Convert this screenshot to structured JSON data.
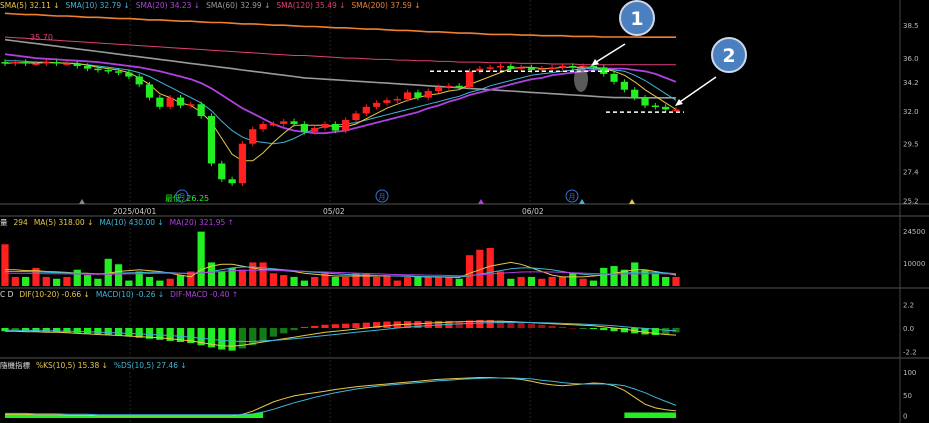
{
  "legends": {
    "price": [
      {
        "text": "SMA(5) 32.11 ↓",
        "color": "#e8c84a"
      },
      {
        "text": "SMA(10) 32.79 ↓",
        "color": "#3fb6d8"
      },
      {
        "text": "SMA(20) 34.23 ↓",
        "color": "#b040e0"
      },
      {
        "text": "SMA(60) 32.99 ↓",
        "color": "#9a9a9a"
      },
      {
        "text": "SMA(120) 35.49 ↓",
        "color": "#e0407a"
      },
      {
        "text": "SMA(200) 37.59 ↓",
        "color": "#f08030"
      }
    ],
    "volume": [
      {
        "text": "量",
        "color": "#dddddd"
      },
      {
        "text": "294",
        "color": "#e8c84a"
      },
      {
        "text": "MA(5) 318.00 ↓",
        "color": "#e8c84a"
      },
      {
        "text": "MA(10) 430.00 ↓",
        "color": "#3fb6d8"
      },
      {
        "text": "MA(20) 321.95 ↑",
        "color": "#b040e0"
      }
    ],
    "macd": [
      {
        "text": "C D",
        "color": "#dddddd"
      },
      {
        "text": "DIF(10-20) -0.66 ↓",
        "color": "#e8c84a"
      },
      {
        "text": "MACD(10) -0.26 ↓",
        "color": "#3fb6d8"
      },
      {
        "text": "DIF-MACD -0.40 ↑",
        "color": "#b040e0"
      }
    ],
    "kd": [
      {
        "text": "隨機指標",
        "color": "#dddddd"
      },
      {
        "text": "%KS(10,5) 15.38 ↓",
        "color": "#e8c84a"
      },
      {
        "text": "%DS(10,5) 27.46 ↓",
        "color": "#3fb6d8"
      }
    ]
  },
  "annotations": {
    "low_label": "最低: 26.25",
    "marker_1": "1",
    "marker_2": "2",
    "month_badge": "月",
    "top_left_value": "35.70"
  },
  "colors": {
    "up": "#ff2020",
    "down": "#22ee22",
    "sma5": "#e8c84a",
    "sma10": "#3fb6d8",
    "sma20": "#b040e0",
    "sma60": "#9a9a9a",
    "sma120": "#e0407a",
    "sma200": "#f08030",
    "grid": "#262626",
    "marker": "#4a7fc0"
  },
  "chart_data": [
    {
      "type": "candlestick",
      "title": "",
      "x_labels": [
        "2025/04/01",
        "05/02",
        "06/02"
      ],
      "ylim": [
        25,
        39.5
      ],
      "y_ticks": [
        25.2,
        27.4,
        29.5,
        32.0,
        34.2,
        36.0,
        38.5
      ],
      "close": [
        35.6,
        35.7,
        35.6,
        35.6,
        35.7,
        35.6,
        35.6,
        35.4,
        35.2,
        35.1,
        35.0,
        34.9,
        34.6,
        34.0,
        33.0,
        32.3,
        33.0,
        32.4,
        32.5,
        31.6,
        28.0,
        26.8,
        26.5,
        29.5,
        30.6,
        31.0,
        31.0,
        31.2,
        31.0,
        30.4,
        30.7,
        31.0,
        30.5,
        31.3,
        31.8,
        32.3,
        32.6,
        32.8,
        32.9,
        33.4,
        33.0,
        33.5,
        33.8,
        33.9,
        33.8,
        35.0,
        35.2,
        35.3,
        35.4,
        35.2,
        35.3,
        35.1,
        35.2,
        35.3,
        35.4,
        35.3,
        35.4,
        35.3,
        34.8,
        34.2,
        33.6,
        33.0,
        32.4,
        32.3,
        32.1,
        32.1
      ],
      "sma5": [
        35.6,
        35.65,
        35.63,
        35.63,
        35.64,
        35.64,
        35.62,
        35.6,
        35.45,
        35.3,
        35.2,
        35.1,
        34.9,
        34.5,
        34.0,
        33.3,
        33.0,
        32.6,
        32.4,
        31.9,
        31.1,
        29.9,
        28.7,
        28.2,
        28.2,
        28.8,
        29.6,
        30.3,
        30.9,
        30.9,
        30.9,
        30.9,
        30.8,
        30.8,
        31.0,
        31.4,
        31.8,
        32.2,
        32.5,
        32.8,
        33.0,
        33.2,
        33.3,
        33.5,
        33.6,
        34.0,
        34.3,
        34.6,
        34.9,
        35.2,
        35.3,
        35.3,
        35.2,
        35.2,
        35.3,
        35.3,
        35.3,
        35.3,
        35.2,
        35.0,
        34.7,
        34.2,
        33.6,
        33.1,
        32.6,
        32.1
      ],
      "sma10": [
        35.8,
        35.8,
        35.75,
        35.7,
        35.7,
        35.65,
        35.6,
        35.55,
        35.5,
        35.4,
        35.3,
        35.2,
        35.1,
        34.9,
        34.6,
        34.2,
        33.8,
        33.4,
        33.0,
        32.6,
        32.0,
        31.2,
        30.5,
        30.0,
        29.7,
        29.6,
        29.5,
        29.6,
        29.9,
        30.3,
        30.6,
        30.8,
        30.9,
        31.0,
        31.1,
        31.3,
        31.5,
        31.7,
        31.9,
        32.1,
        32.3,
        32.5,
        32.7,
        32.9,
        33.1,
        33.4,
        33.6,
        33.9,
        34.1,
        34.3,
        34.5,
        34.7,
        34.8,
        34.9,
        35.0,
        35.1,
        35.2,
        35.2,
        35.2,
        35.1,
        35.0,
        34.7,
        34.3,
        33.8,
        33.3,
        32.8
      ],
      "sma20": [
        36.3,
        36.2,
        36.1,
        36.0,
        35.95,
        35.9,
        35.85,
        35.8,
        35.75,
        35.7,
        35.6,
        35.5,
        35.4,
        35.3,
        35.15,
        35.0,
        34.8,
        34.6,
        34.4,
        34.1,
        33.7,
        33.2,
        32.7,
        32.2,
        31.8,
        31.4,
        31.0,
        30.7,
        30.5,
        30.4,
        30.3,
        30.3,
        30.4,
        30.5,
        30.7,
        30.9,
        31.1,
        31.3,
        31.5,
        31.7,
        31.9,
        32.2,
        32.4,
        32.7,
        32.9,
        33.2,
        33.4,
        33.6,
        33.8,
        34.0,
        34.2,
        34.4,
        34.5,
        34.7,
        34.8,
        34.9,
        35.0,
        35.1,
        35.2,
        35.2,
        35.2,
        35.1,
        35.0,
        34.8,
        34.5,
        34.2
      ],
      "sma60": [
        37.4,
        37.3,
        37.2,
        37.1,
        37.0,
        36.9,
        36.8,
        36.7,
        36.6,
        36.5,
        36.4,
        36.3,
        36.2,
        36.1,
        36.0,
        35.9,
        35.8,
        35.7,
        35.6,
        35.5,
        35.4,
        35.3,
        35.2,
        35.1,
        35.0,
        34.9,
        34.8,
        34.7,
        34.6,
        34.5,
        34.45,
        34.4,
        34.35,
        34.3,
        34.25,
        34.2,
        34.15,
        34.1,
        34.05,
        34.0,
        33.95,
        33.9,
        33.85,
        33.8,
        33.75,
        33.7,
        33.65,
        33.6,
        33.55,
        33.5,
        33.45,
        33.4,
        33.35,
        33.3,
        33.25,
        33.2,
        33.15,
        33.1,
        33.05,
        33.0,
        33.0,
        32.99,
        32.99,
        32.99,
        32.99,
        32.99
      ],
      "sma120": [
        37.6,
        37.55,
        37.5,
        37.45,
        37.4,
        37.35,
        37.3,
        37.25,
        37.2,
        37.15,
        37.1,
        37.05,
        37.0,
        36.95,
        36.9,
        36.85,
        36.8,
        36.75,
        36.7,
        36.65,
        36.6,
        36.55,
        36.5,
        36.45,
        36.4,
        36.35,
        36.3,
        36.25,
        36.2,
        36.2,
        36.15,
        36.1,
        36.05,
        36.0,
        36.0,
        35.95,
        35.9,
        35.9,
        35.85,
        35.85,
        35.8,
        35.8,
        35.75,
        35.75,
        35.7,
        35.7,
        35.7,
        35.65,
        35.65,
        35.65,
        35.6,
        35.6,
        35.6,
        35.55,
        35.55,
        35.55,
        35.5,
        35.5,
        35.5,
        35.5,
        35.5,
        35.5,
        35.49,
        35.49,
        35.49,
        35.49
      ],
      "sma200": [
        39.4,
        39.35,
        39.3,
        39.3,
        39.25,
        39.2,
        39.2,
        39.15,
        39.1,
        39.1,
        39.05,
        39.0,
        39.0,
        38.95,
        38.9,
        38.9,
        38.85,
        38.8,
        38.8,
        38.75,
        38.7,
        38.7,
        38.65,
        38.6,
        38.6,
        38.55,
        38.5,
        38.5,
        38.45,
        38.4,
        38.4,
        38.35,
        38.3,
        38.3,
        38.25,
        38.2,
        38.2,
        38.15,
        38.1,
        38.1,
        38.05,
        38.0,
        38.0,
        37.95,
        37.9,
        37.9,
        37.85,
        37.8,
        37.8,
        37.8,
        37.75,
        37.75,
        37.7,
        37.7,
        37.7,
        37.65,
        37.65,
        37.65,
        37.6,
        37.6,
        37.6,
        37.6,
        37.59,
        37.59,
        37.59,
        37.59
      ]
    },
    {
      "type": "bar",
      "title": "",
      "y_ticks": [
        "24500",
        "10000"
      ],
      "volume": [
        2300,
        500,
        500,
        1000,
        500,
        400,
        500,
        900,
        600,
        400,
        1500,
        1200,
        300,
        800,
        500,
        300,
        400,
        600,
        800,
        3000,
        1300,
        800,
        1000,
        900,
        1300,
        1300,
        700,
        600,
        500,
        300,
        500,
        700,
        500,
        500,
        700,
        700,
        500,
        600,
        300,
        500,
        500,
        500,
        500,
        500,
        400,
        1700,
        2000,
        2100,
        800,
        400,
        500,
        500,
        400,
        500,
        500,
        700,
        400,
        300,
        1000,
        1100,
        900,
        1300,
        900,
        700,
        500,
        500
      ],
      "ma5": [
        900,
        900,
        850,
        850,
        800,
        780,
        750,
        700,
        700,
        650,
        700,
        800,
        850,
        900,
        850,
        800,
        700,
        600,
        500,
        900,
        1100,
        1200,
        1200,
        1100,
        1000,
        900,
        900,
        850,
        800,
        700,
        650,
        600,
        550,
        550,
        550,
        550,
        550,
        550,
        550,
        550,
        520,
        500,
        500,
        480,
        470,
        700,
        900,
        1100,
        1200,
        1300,
        1200,
        1000,
        800,
        600,
        500,
        500,
        500,
        550,
        600,
        700,
        800,
        900,
        900,
        800,
        700,
        600
      ],
      "ma10": [
        800,
        800,
        800,
        780,
        760,
        740,
        720,
        700,
        690,
        680,
        680,
        700,
        720,
        740,
        760,
        760,
        740,
        700,
        680,
        700,
        800,
        900,
        1000,
        1050,
        1050,
        1000,
        950,
        900,
        850,
        800,
        760,
        720,
        680,
        640,
        620,
        600,
        580,
        560,
        550,
        540,
        530,
        520,
        510,
        500,
        500,
        550,
        650,
        750,
        850,
        950,
        1000,
        1000,
        950,
        900,
        800,
        700,
        650,
        600,
        600,
        650,
        700,
        750,
        780,
        750,
        720,
        680
      ],
      "ma20": [
        700,
        700,
        700,
        690,
        680,
        680,
        670,
        660,
        650,
        650,
        650,
        660,
        670,
        680,
        690,
        700,
        700,
        700,
        700,
        720,
        760,
        800,
        840,
        860,
        870,
        870,
        860,
        850,
        830,
        810,
        790,
        770,
        750,
        730,
        710,
        690,
        670,
        650,
        630,
        620,
        610,
        600,
        590,
        580,
        570,
        580,
        620,
        660,
        700,
        740,
        770,
        780,
        780,
        770,
        750,
        730,
        710,
        690,
        670,
        660,
        660,
        670,
        680,
        680,
        670,
        660
      ]
    },
    {
      "type": "bar",
      "title": "",
      "y_ticks": [
        "2.2",
        "0.0",
        "-2.2"
      ],
      "osc": [
        -0.3,
        -0.25,
        -0.3,
        -0.35,
        -0.35,
        -0.4,
        -0.4,
        -0.45,
        -0.5,
        -0.55,
        -0.6,
        -0.7,
        -0.8,
        -0.9,
        -1.0,
        -1.1,
        -1.2,
        -1.3,
        -1.4,
        -1.6,
        -1.8,
        -2.0,
        -2.1,
        -1.9,
        -1.6,
        -1.2,
        -0.8,
        -0.5,
        -0.2,
        0.1,
        0.2,
        0.3,
        0.35,
        0.4,
        0.45,
        0.5,
        0.55,
        0.6,
        0.62,
        0.64,
        0.65,
        0.66,
        0.66,
        0.66,
        0.64,
        0.7,
        0.74,
        0.74,
        0.7,
        0.6,
        0.5,
        0.4,
        0.3,
        0.2,
        0.1,
        0.0,
        -0.05,
        -0.1,
        -0.2,
        -0.3,
        -0.4,
        -0.5,
        -0.6,
        -0.65,
        -0.6,
        -0.4
      ],
      "dif": [
        -0.3,
        -0.3,
        -0.35,
        -0.35,
        -0.4,
        -0.4,
        -0.45,
        -0.5,
        -0.55,
        -0.6,
        -0.65,
        -0.7,
        -0.75,
        -0.8,
        -0.85,
        -0.9,
        -1.0,
        -1.1,
        -1.2,
        -1.35,
        -1.5,
        -1.65,
        -1.7,
        -1.6,
        -1.45,
        -1.3,
        -1.15,
        -1.0,
        -0.85,
        -0.7,
        -0.55,
        -0.4,
        -0.3,
        -0.2,
        -0.1,
        0.0,
        0.1,
        0.2,
        0.3,
        0.35,
        0.4,
        0.45,
        0.5,
        0.55,
        0.58,
        0.6,
        0.62,
        0.63,
        0.62,
        0.6,
        0.55,
        0.5,
        0.45,
        0.4,
        0.35,
        0.3,
        0.25,
        0.2,
        0.1,
        0.0,
        -0.1,
        -0.25,
        -0.4,
        -0.5,
        -0.6,
        -0.66
      ],
      "macd": [
        -0.2,
        -0.2,
        -0.22,
        -0.24,
        -0.26,
        -0.28,
        -0.3,
        -0.32,
        -0.35,
        -0.38,
        -0.42,
        -0.46,
        -0.5,
        -0.55,
        -0.6,
        -0.65,
        -0.7,
        -0.78,
        -0.86,
        -0.95,
        -1.05,
        -1.15,
        -1.22,
        -1.25,
        -1.24,
        -1.2,
        -1.15,
        -1.08,
        -1.0,
        -0.9,
        -0.8,
        -0.7,
        -0.6,
        -0.5,
        -0.4,
        -0.3,
        -0.2,
        -0.1,
        0.0,
        0.08,
        0.15,
        0.22,
        0.28,
        0.33,
        0.38,
        0.42,
        0.46,
        0.49,
        0.51,
        0.52,
        0.52,
        0.51,
        0.49,
        0.46,
        0.43,
        0.4,
        0.36,
        0.32,
        0.27,
        0.2,
        0.12,
        0.04,
        -0.04,
        -0.12,
        -0.2,
        -0.26
      ]
    },
    {
      "type": "line",
      "title": "",
      "y_ticks": [
        "100",
        "50",
        "0"
      ],
      "k": [
        8,
        8,
        8,
        7,
        7,
        7,
        6,
        6,
        6,
        5,
        5,
        5,
        5,
        5,
        5,
        5,
        5,
        5,
        5,
        5,
        5,
        5,
        5,
        8,
        15,
        25,
        35,
        42,
        48,
        52,
        55,
        58,
        62,
        65,
        68,
        70,
        72,
        74,
        76,
        78,
        80,
        82,
        84,
        85,
        86,
        87,
        88,
        88,
        87,
        86,
        84,
        80,
        75,
        72,
        70,
        72,
        74,
        76,
        75,
        70,
        60,
        45,
        30,
        22,
        18,
        15.38
      ],
      "d": [
        10,
        10,
        10,
        9,
        9,
        9,
        8,
        8,
        8,
        7,
        7,
        7,
        7,
        7,
        7,
        7,
        7,
        7,
        7,
        7,
        7,
        7,
        7,
        7,
        9,
        13,
        19,
        26,
        33,
        39,
        45,
        50,
        55,
        59,
        63,
        66,
        69,
        71,
        73,
        75,
        77,
        79,
        81,
        82,
        84,
        85,
        86,
        87,
        87,
        87,
        86,
        85,
        82,
        80,
        77,
        75,
        74,
        74,
        74,
        73,
        70,
        63,
        55,
        45,
        36,
        27.46
      ]
    }
  ]
}
